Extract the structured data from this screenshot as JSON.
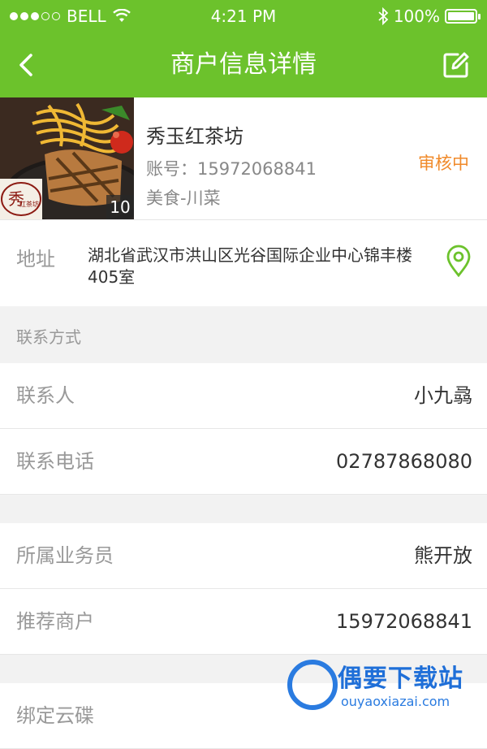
{
  "status_bar": {
    "carrier": "BELL",
    "time": "4:21 PM",
    "battery": "100%",
    "battery_level": 1.0
  },
  "nav": {
    "title": "商户信息详情",
    "back_icon": "back-arrow-icon",
    "edit_icon": "edit-icon"
  },
  "merchant": {
    "name": "秀玉红茶坊",
    "account": "账号：15972068841",
    "category": "美食-川菜",
    "status": "审核中",
    "photo_count": "10",
    "logo_text": "秀 红茶坊"
  },
  "address": {
    "label": "地址",
    "value": "湖北省武汉市洪山区光谷国际企业中心锦丰楼405室",
    "icon": "location-pin-icon"
  },
  "contact_section": {
    "title": "联系方式",
    "rows": [
      {
        "label": "联系人",
        "value": "小九骉"
      },
      {
        "label": "联系电话",
        "value": "02787868080"
      }
    ]
  },
  "business_section": {
    "rows": [
      {
        "label": "所属业务员",
        "value": "熊开放"
      },
      {
        "label": "推荐商户",
        "value": "15972068841"
      }
    ]
  },
  "cloud_section": {
    "rows": [
      {
        "label": "绑定云碟",
        "value": ""
      }
    ]
  },
  "watermark": {
    "title": "偶要下载站",
    "url": "ouyaoxiazai.com"
  },
  "colors": {
    "brand_green": "#6cc22c",
    "status_orange": "#f08a2a"
  }
}
